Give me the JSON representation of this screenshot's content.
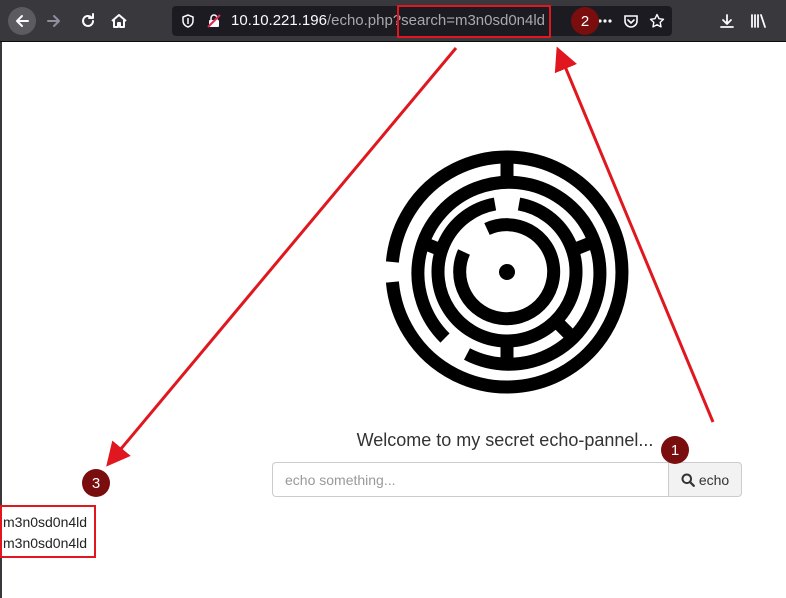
{
  "browser": {
    "url_host": "10.10.221.196",
    "url_path": "/echo.php?search=m3n0sd0n4ld",
    "icons": [
      "back-icon",
      "forward-icon",
      "reload-icon",
      "home-icon",
      "shield-icon",
      "insecure-lock-icon",
      "more-icon",
      "pocket-icon",
      "bookmark-star-icon",
      "download-icon",
      "library-icon"
    ]
  },
  "page": {
    "welcome": "Welcome to my secret echo-pannel...",
    "input_placeholder": "echo something...",
    "button_label": "echo",
    "output_lines": [
      "m3n0sd0n4ld",
      "m3n0sd0n4ld"
    ]
  },
  "annotations": {
    "badges": [
      "1",
      "2",
      "3"
    ],
    "color": "#e0171f",
    "badge_color": "#7a0d0d"
  }
}
